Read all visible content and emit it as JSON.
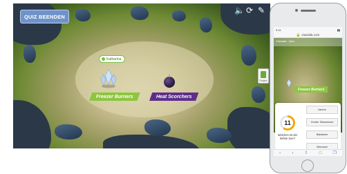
{
  "game": {
    "quit_label": "QUIZ BEENDEN",
    "player_name": "Katharina",
    "teams": [
      {
        "name": "Freezer Burners",
        "color": "#8cc63e"
      },
      {
        "name": "Heat Scorchers",
        "color": "#5d2d8c"
      }
    ],
    "side_label": "Project",
    "controls": {
      "sound": "sound-icon",
      "restart": "restart-icon",
      "edit": "pencil-icon"
    }
  },
  "phone": {
    "status_time": "9:41",
    "url": "classlab.com",
    "header_text": "Classlab · Quiz",
    "team": "Freezer Burners",
    "timer": "11",
    "question": "Welches ist der tiefste See?",
    "answers": [
      "Vanern",
      "Großer Sklavensee",
      "Baikalsee",
      "Wannsee"
    ]
  },
  "colors": {
    "accent_quit": "#6f93c9",
    "team_green": "#8cc63e",
    "team_purple": "#5d2d8c",
    "timer": "#f2a900"
  }
}
